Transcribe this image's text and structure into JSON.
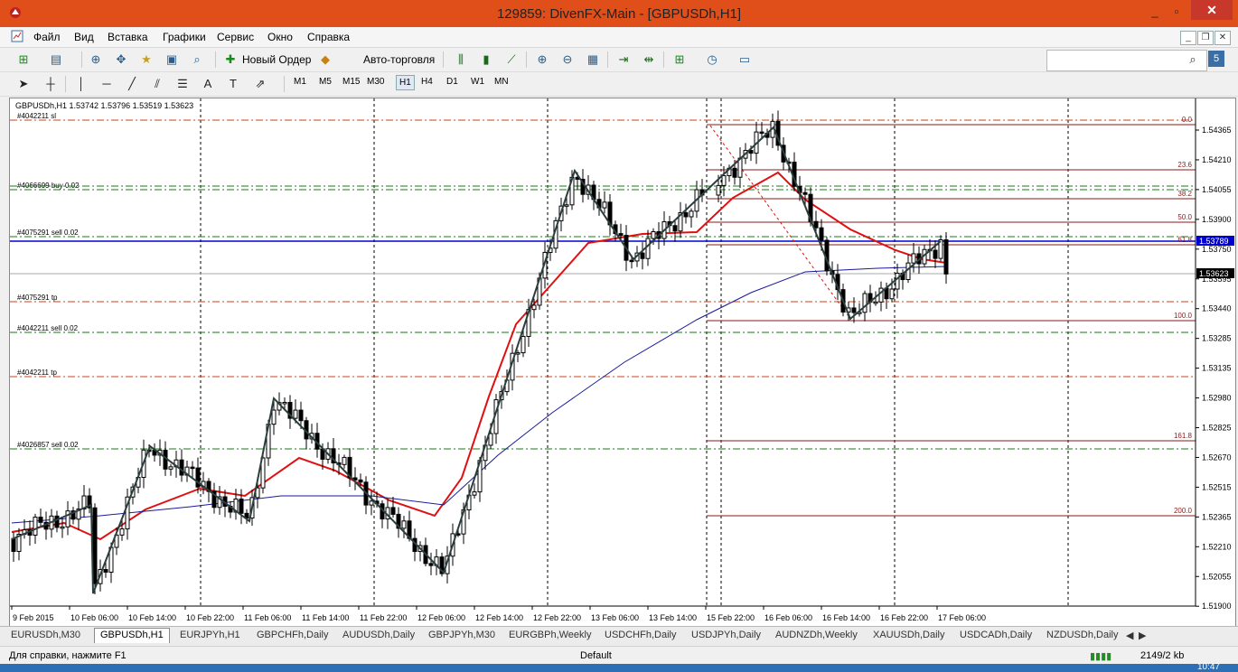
{
  "window": {
    "title": "129859: DivenFX-Main - [GBPUSDh,H1]",
    "accent": "#e04e1a"
  },
  "menu": [
    "Файл",
    "Вид",
    "Вставка",
    "Графики",
    "Сервис",
    "Окно",
    "Справка"
  ],
  "toolbar": {
    "new_order": "Новый Ордер",
    "auto_trading": "Авто-торговля"
  },
  "timeframes": [
    "M1",
    "M5",
    "M15",
    "M30",
    "H1",
    "H4",
    "D1",
    "W1",
    "MN"
  ],
  "active_timeframe": "H1",
  "chart": {
    "header": "GBPUSDh,H1  1.53742 1.53796 1.53519 1.53623",
    "bid_price": "1.53623",
    "blue_line_price": "1.53789",
    "price_labels": [
      "1.54365",
      "1.54210",
      "1.54055",
      "1.53900",
      "1.53750",
      "1.53595",
      "1.53440",
      "1.53285",
      "1.53135",
      "1.52980",
      "1.52825",
      "1.52670",
      "1.52515",
      "1.52365",
      "1.52210",
      "1.52055",
      "1.51900"
    ],
    "time_labels": [
      "9 Feb 2015",
      "10 Feb 06:00",
      "10 Feb 14:00",
      "10 Feb 22:00",
      "11 Feb 06:00",
      "11 Feb 14:00",
      "11 Feb 22:00",
      "12 Feb 06:00",
      "12 Feb 14:00",
      "12 Feb 22:00",
      "13 Feb 06:00",
      "13 Feb 14:00",
      "15 Feb 22:00",
      "16 Feb 06:00",
      "16 Feb 14:00",
      "16 Feb 22:00",
      "17 Feb 06:00"
    ],
    "order_labels": [
      {
        "text": "#4042211 sl",
        "color": "#d04010"
      },
      {
        "text": "#4066699 buy 0.02",
        "color": "#1a7a1a"
      },
      {
        "text": "#4075291 sell 0.02",
        "color": "#1a7a1a"
      },
      {
        "text": "#4075291 tp",
        "color": "#d04010"
      },
      {
        "text": "#4042211 sell 0.02",
        "color": "#1a7a1a"
      },
      {
        "text": "#4042211 tp",
        "color": "#d04010"
      },
      {
        "text": "#4026857 sell 0.02",
        "color": "#1a7a1a"
      }
    ],
    "fib_labels": [
      "0.0",
      "23.6",
      "38.2",
      "50.0",
      "61.8",
      "100.0",
      "161.8",
      "200.0"
    ],
    "colors": {
      "ma_fast": "#e01010",
      "ma_slow": "#1a1a9a",
      "zigzag": "#2b3d3d",
      "fib": "#8b1a1a"
    }
  },
  "tabs": [
    "EURUSDh,M30",
    "GBPUSDh,H1",
    "EURJPYh,H1",
    "GBPCHFh,Daily",
    "AUDUSDh,Daily",
    "GBPJPYh,M30",
    "EURGBPh,Weekly",
    "USDCHFh,Daily",
    "USDJPYh,Daily",
    "AUDNZDh,Weekly",
    "XAUUSDh,Daily",
    "USDCADh,Daily",
    "NZDUSDh,Daily"
  ],
  "active_tab": "GBPUSDh,H1",
  "status": {
    "help": "Для справки, нажмите F1",
    "profile": "Default",
    "traffic": "2149/2 kb"
  },
  "clock": "10:47"
}
